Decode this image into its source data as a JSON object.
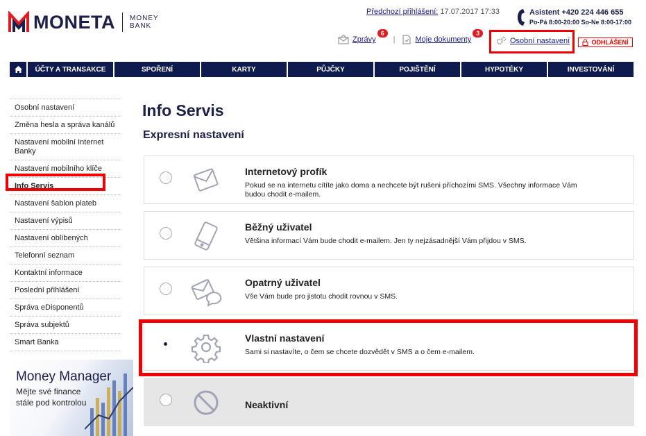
{
  "brand": {
    "name": "MONETA",
    "sub_line1": "MONEY",
    "sub_line2": "BANK",
    "colors": {
      "primary": "#1b1f4a",
      "nav": "#0f1a4e",
      "accent": "#e21a22"
    }
  },
  "header": {
    "prev_login_label": "Předchozí přihlášení:",
    "prev_login_value": "17.07.2017 17:33",
    "assistant": "Asistent +420 224 446 655",
    "hours": "Po-Pá 8:00-20:00 So-Ne 8:00-17:00",
    "messages_label": "Zprávy",
    "messages_count": "6",
    "documents_label": "Moje dokumenty",
    "documents_count": "3",
    "separator": "|",
    "settings_label": "Osobní nastavení",
    "logout_label": "ODHLÁŠENÍ"
  },
  "nav": {
    "home_icon": "home-icon",
    "items": [
      {
        "label": "ÚČTY A TRANSAKCE"
      },
      {
        "label": "SPOŘENÍ"
      },
      {
        "label": "KARTY"
      },
      {
        "label": "PŮJČKY"
      },
      {
        "label": "POJIŠTĚNÍ"
      },
      {
        "label": "HYPOTÉKY"
      },
      {
        "label": "INVESTOVÁNÍ"
      }
    ]
  },
  "sidebar": {
    "items": [
      {
        "label": "Osobní nastavení"
      },
      {
        "label": "Změna hesla a správa kanálů"
      },
      {
        "label": "Nastavení mobilní Internet Banky"
      },
      {
        "label": "Nastavení mobilního klíče"
      },
      {
        "label": "Info Servis",
        "active": true
      },
      {
        "label": "Nastavení šablon plateb"
      },
      {
        "label": "Nastavení výpisů"
      },
      {
        "label": "Nastavení oblíbených"
      },
      {
        "label": "Telefonní seznam"
      },
      {
        "label": "Kontaktní informace"
      },
      {
        "label": "Poslední přihlášení"
      },
      {
        "label": "Správa eDisponentů"
      },
      {
        "label": "Správa subjektů"
      },
      {
        "label": "Smart Banka"
      }
    ]
  },
  "promo": {
    "title": "Money Manager",
    "text": "Mějte své finance stále pod kontrolou"
  },
  "main": {
    "title": "Info Servis",
    "subtitle": "Expresní nastavení",
    "options": [
      {
        "title": "Internetový profík",
        "desc": "Pokud se na internetu cítíte jako doma a nechcete být rušeni příchozími SMS. Všechny informace Vám budou chodit e-mailem.",
        "icon": "envelope-icon",
        "selected": false
      },
      {
        "title": "Běžný uživatel",
        "desc": "Většina informací Vám bude chodit e-mailem. Jen ty nejzásadnější Vám přijdou v SMS.",
        "icon": "phone-icon",
        "selected": false
      },
      {
        "title": "Opatrný uživatel",
        "desc": "Vše Vám bude pro jistotu chodit rovnou v SMS.",
        "icon": "envelope-chat-icon",
        "selected": false
      },
      {
        "title": "Vlastní nastavení",
        "desc": "Sami si nastavíte, o čem se chcete dozvědět v SMS a o čem e-mailem.",
        "icon": "gear-icon",
        "selected": true
      },
      {
        "title": "Neaktivní",
        "desc": "",
        "icon": "prohibited-icon",
        "selected": false
      }
    ]
  }
}
